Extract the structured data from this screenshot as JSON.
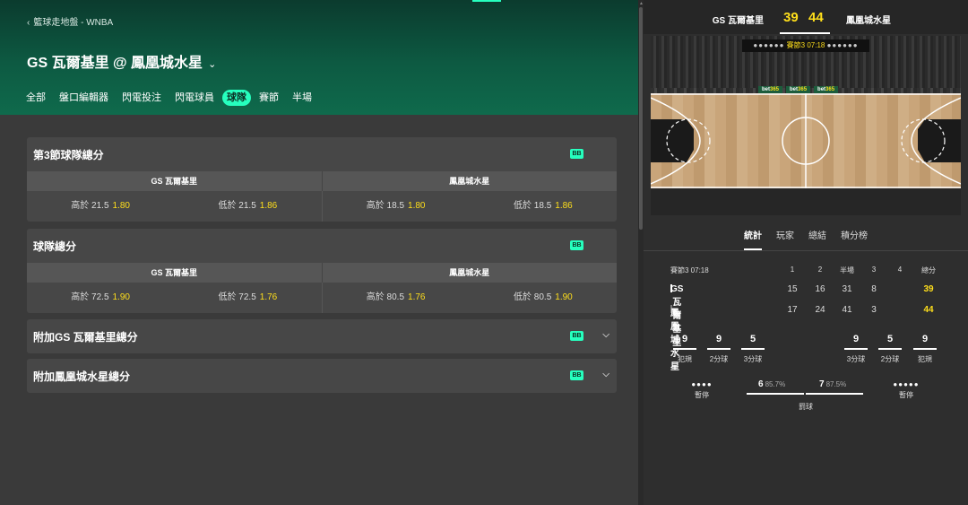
{
  "header": {
    "breadcrumb": "籃球走地盤 - WNBA",
    "title": "GS 瓦爾基里 @ 鳳凰城水星",
    "tabs": [
      "全部",
      "盤口編輯器",
      "閃電投注",
      "閃電球員",
      "球隊",
      "賽節",
      "半場"
    ],
    "active_tab": "球隊"
  },
  "markets": [
    {
      "title": "第3節球隊總分",
      "badge": "BB",
      "team1": "GS 瓦爾基里",
      "team2": "鳳凰城水星",
      "odds": [
        {
          "label": "高於 21.5",
          "price": "1.80"
        },
        {
          "label": "低於 21.5",
          "price": "1.86"
        },
        {
          "label": "高於 18.5",
          "price": "1.80"
        },
        {
          "label": "低於 18.5",
          "price": "1.86"
        }
      ]
    },
    {
      "title": "球隊總分",
      "badge": "BB",
      "team1": "GS 瓦爾基里",
      "team2": "鳳凰城水星",
      "odds": [
        {
          "label": "高於 72.5",
          "price": "1.90"
        },
        {
          "label": "低於 72.5",
          "price": "1.76"
        },
        {
          "label": "高於 80.5",
          "price": "1.76"
        },
        {
          "label": "低於 80.5",
          "price": "1.90"
        }
      ]
    },
    {
      "title": "附加GS 瓦爾基里總分",
      "badge": "BB"
    },
    {
      "title": "附加鳳凰城水星總分",
      "badge": "BB"
    }
  ],
  "scoreboard": {
    "team1": "GS 瓦爾基里",
    "score1": "39",
    "team2": "鳳凰城水星",
    "score2": "44"
  },
  "court": {
    "period_label": "賽節3",
    "clock": "07:18",
    "ad_text": "bet",
    "ad_num": "365"
  },
  "stats_tabs": [
    "統計",
    "玩家",
    "總結",
    "積分榜"
  ],
  "stats_table": {
    "period": "賽節3 07:18",
    "headers": [
      "1",
      "2",
      "半場",
      "3",
      "4",
      "總分"
    ],
    "rows": [
      {
        "team": "GS 瓦爾基里",
        "q": [
          "15",
          "16",
          "31",
          "8",
          ""
        ],
        "total": "39"
      },
      {
        "team": "鳳凰城水星",
        "q": [
          "17",
          "24",
          "41",
          "3",
          ""
        ],
        "total": "44"
      }
    ]
  },
  "team_stats": {
    "left": [
      {
        "value": "9",
        "label": "犯規"
      },
      {
        "value": "9",
        "label": "2分球"
      },
      {
        "value": "5",
        "label": "3分球"
      }
    ],
    "right": [
      {
        "value": "9",
        "label": "3分球"
      },
      {
        "value": "5",
        "label": "2分球"
      },
      {
        "value": "9",
        "label": "犯規"
      }
    ],
    "timeout_label": "暫停",
    "free_throw_label": "罰球",
    "ft1": {
      "value": "6",
      "pct": "85.7%"
    },
    "ft2": {
      "value": "7",
      "pct": "87.5%"
    }
  },
  "colors": {
    "accent": "#26ffbe",
    "odds": "#ffdf1b",
    "hero": "#0d5a42"
  }
}
